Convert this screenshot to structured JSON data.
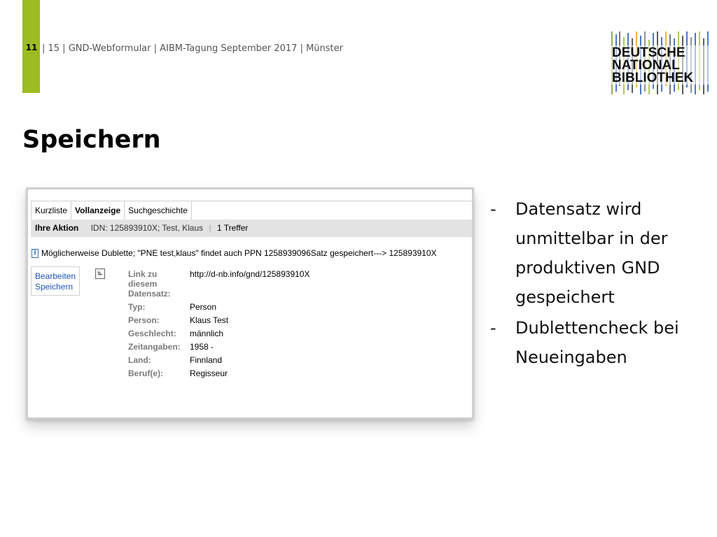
{
  "header": {
    "page_number": "11",
    "info": "| 15 | GND-Webformular | AIBM-Tagung September 2017 | Münster"
  },
  "logo": {
    "text_lines": [
      "DEUTSCHE",
      "NATIONAL",
      "BIBLIOTHEK"
    ]
  },
  "title": "Speichern",
  "screenshot": {
    "tabs": [
      {
        "label": "Kurzliste",
        "active": false
      },
      {
        "label": "Vollanzeige",
        "active": true
      },
      {
        "label": "Suchgeschichte",
        "active": false
      }
    ],
    "action_bar": {
      "label": "Ihre Aktion",
      "idn": "IDN: 125893910X; Test, Klaus",
      "separator": "|",
      "hits": "1 Treffer"
    },
    "notice": "Möglicherweise Dublette; \"PNE test,klaus\" findet auch PPN 1258939096Satz gespeichert---> 125893910X",
    "edit_links": [
      "Bearbeiten",
      "Speichern"
    ],
    "record": [
      {
        "label": "Link zu diesem Datensatz:",
        "value": "http://d-nb.info/gnd/125893910X"
      },
      {
        "label": "Typ:",
        "value": "Person"
      },
      {
        "label": "Person:",
        "value": "Klaus Test"
      },
      {
        "label": "Geschlecht:",
        "value": "männlich"
      },
      {
        "label": "Zeitangaben:",
        "value": "1958 -"
      },
      {
        "label": "Land:",
        "value": "Finnland"
      },
      {
        "label": "Beruf(e):",
        "value": "Regisseur"
      }
    ]
  },
  "bullets": [
    {
      "dash": "-",
      "text": "Datensatz wird unmittelbar in der produktiven GND gespeichert"
    },
    {
      "dash": "-",
      "text": "Dublettencheck bei Neueingaben"
    }
  ],
  "colors": {
    "accent_green": "#9cbc22",
    "link_blue": "#1f55b8",
    "action_bar_grey": "#e3e3e3"
  }
}
